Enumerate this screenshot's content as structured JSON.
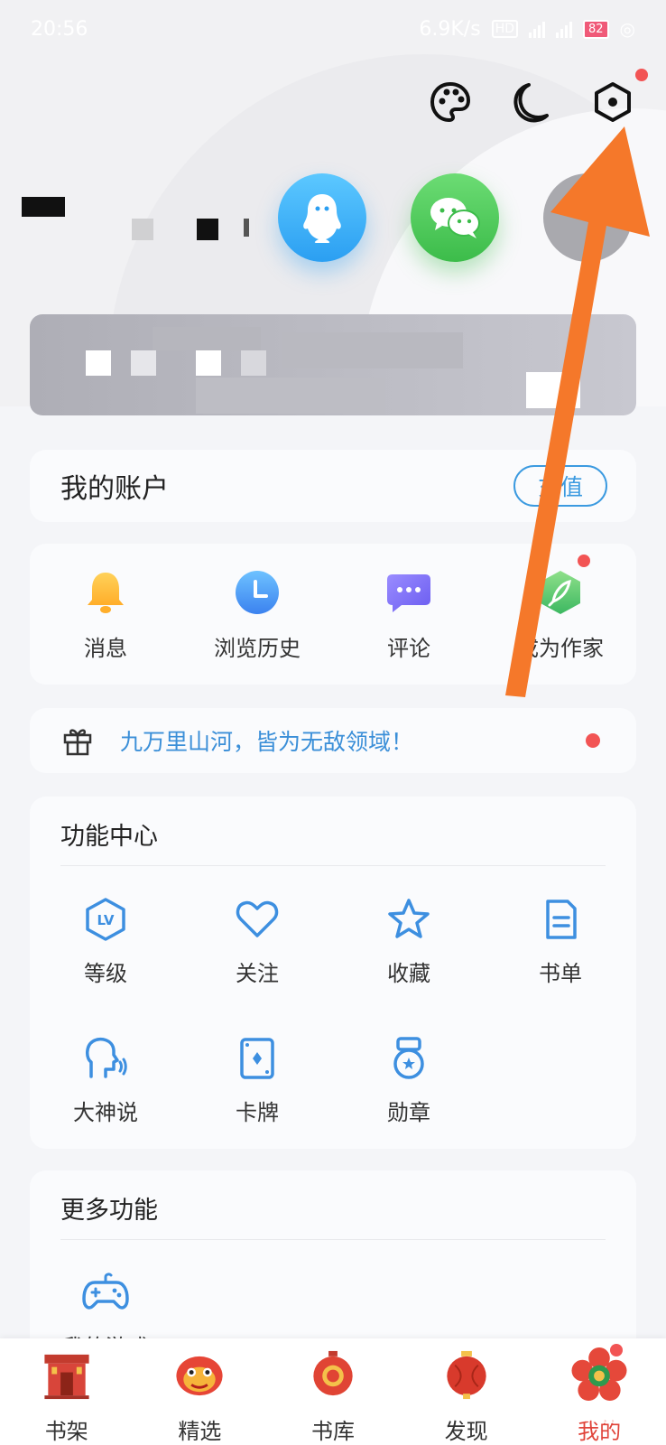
{
  "status_bar": {
    "time": "20:56",
    "net_speed": "6.9K/s",
    "battery": "82"
  },
  "account": {
    "title": "我的账户",
    "recharge_label": "充值"
  },
  "quick_actions": [
    {
      "label": "消息",
      "icon": "bell-icon"
    },
    {
      "label": "浏览历史",
      "icon": "clock-icon"
    },
    {
      "label": "评论",
      "icon": "comment-icon"
    },
    {
      "label": "成为作家",
      "icon": "feather-icon"
    }
  ],
  "notice": {
    "text": "九万里山河，皆为无敌领域！",
    "icon": "gift-icon"
  },
  "function_center": {
    "title": "功能中心",
    "items": [
      {
        "label": "等级",
        "icon": "level-icon"
      },
      {
        "label": "关注",
        "icon": "heart-icon"
      },
      {
        "label": "收藏",
        "icon": "star-icon"
      },
      {
        "label": "书单",
        "icon": "booklist-icon"
      },
      {
        "label": "大神说",
        "icon": "speaker-icon"
      },
      {
        "label": "卡牌",
        "icon": "card-icon"
      },
      {
        "label": "勋章",
        "icon": "medal-icon"
      }
    ]
  },
  "more_functions": {
    "title": "更多功能",
    "items": [
      {
        "label": "我的游戏",
        "icon": "gamepad-icon"
      }
    ]
  },
  "bottom_nav": [
    {
      "label": "书架",
      "icon": "bookshelf-icon",
      "active": false
    },
    {
      "label": "精选",
      "icon": "lion-icon",
      "active": false
    },
    {
      "label": "书库",
      "icon": "lantern-icon",
      "active": false
    },
    {
      "label": "发现",
      "icon": "red-lantern-icon",
      "active": false
    },
    {
      "label": "我的",
      "icon": "flower-icon",
      "active": true
    }
  ],
  "watermark": "Baidu经验",
  "colors": {
    "accent_blue": "#3b9ae0",
    "red_dot": "#f25454",
    "arrow": "#f5782a",
    "active_nav": "#e0443a"
  }
}
